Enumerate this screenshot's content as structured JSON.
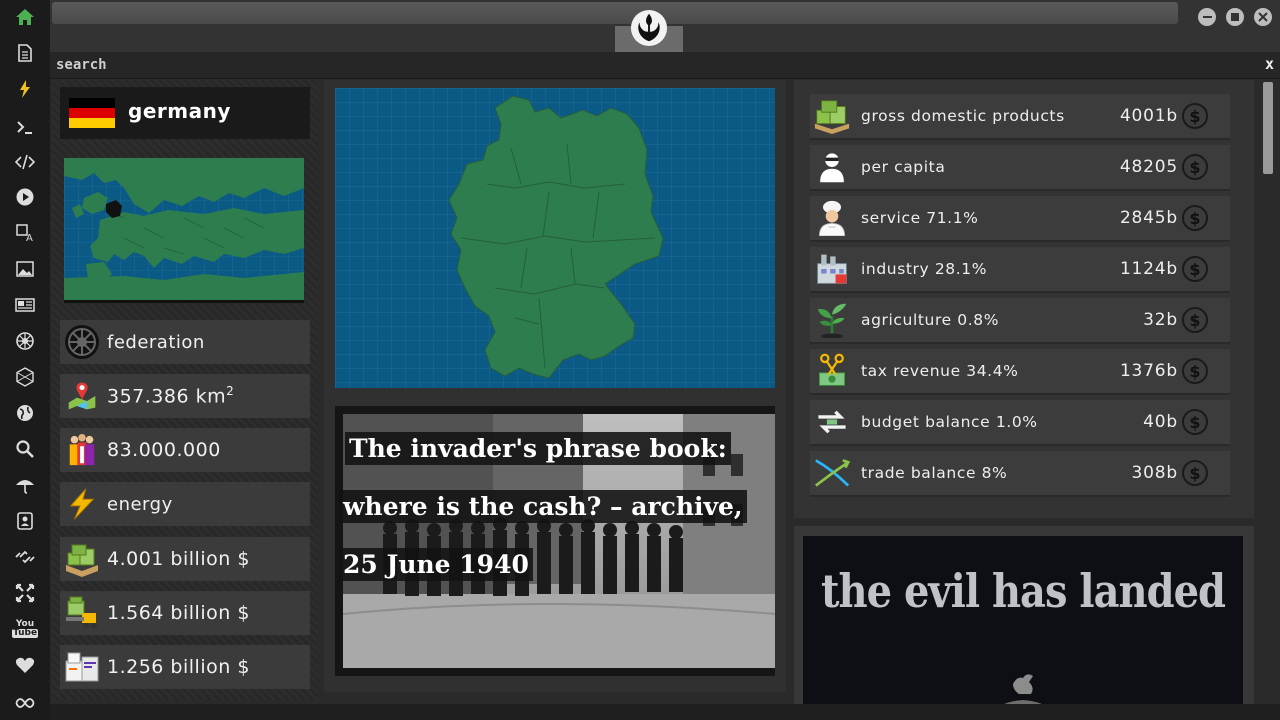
{
  "sidebar": {
    "items": [
      {
        "icon": "home-icon"
      },
      {
        "icon": "document-icon"
      },
      {
        "icon": "lightning-icon"
      },
      {
        "icon": "terminal-icon"
      },
      {
        "icon": "code-icon"
      },
      {
        "icon": "play-icon"
      },
      {
        "icon": "translate-icon"
      },
      {
        "icon": "image-icon"
      },
      {
        "icon": "news-icon"
      },
      {
        "icon": "empire-icon"
      },
      {
        "icon": "hexagon-icon"
      },
      {
        "icon": "globe-icon"
      },
      {
        "icon": "search-icon"
      },
      {
        "icon": "umbrella-icon"
      },
      {
        "icon": "contact-icon"
      },
      {
        "icon": "link-icon"
      },
      {
        "icon": "expand-icon"
      },
      {
        "icon": "youtube-icon"
      },
      {
        "icon": "heart-icon"
      },
      {
        "icon": "infinity-icon"
      }
    ],
    "youtube_label_top": "You",
    "youtube_label_bottom": "Tube"
  },
  "search": {
    "value": "search",
    "close_label": "x"
  },
  "country": {
    "name": "germany",
    "flag_colors": [
      "#000000",
      "#dd0000",
      "#ffcc00"
    ]
  },
  "country_stats": {
    "government": "federation",
    "area": "357.386 km",
    "area_unit_sup": "2",
    "population": "83.000.000",
    "resource": "energy",
    "gdp_total": "4.001 billion $",
    "industry_total": "1.564 billion $",
    "exports_total": "1.256 billion $"
  },
  "news": {
    "line1": "The invader's phrase book:",
    "line2": "where is the cash? – archive,",
    "line3": "25 June 1940"
  },
  "economy": {
    "rows": [
      {
        "label": "gross domestic products",
        "value": "4001b",
        "icon": "money-stack-icon"
      },
      {
        "label": "per capita",
        "value": "48205",
        "icon": "person-icon"
      },
      {
        "label": "service 71.1%",
        "value": "2845b",
        "icon": "chef-icon"
      },
      {
        "label": "industry 28.1%",
        "value": "1124b",
        "icon": "factory-icon"
      },
      {
        "label": "agriculture 0.8%",
        "value": "32b",
        "icon": "sprout-icon"
      },
      {
        "label": "tax revenue 34.4%",
        "value": "1376b",
        "icon": "scissors-money-icon"
      },
      {
        "label": "budget balance 1.0%",
        "value": "40b",
        "icon": "exchange-arrows-icon"
      },
      {
        "label": "trade balance 8%",
        "value": "308b",
        "icon": "trade-cross-icon"
      }
    ],
    "currency_symbol": "$"
  },
  "poster": {
    "title": "the evil has landed"
  },
  "colors": {
    "map_sea": "#0b5a86",
    "map_land": "#2e7d4f",
    "sidebar_bg": "#1b1b1b"
  }
}
